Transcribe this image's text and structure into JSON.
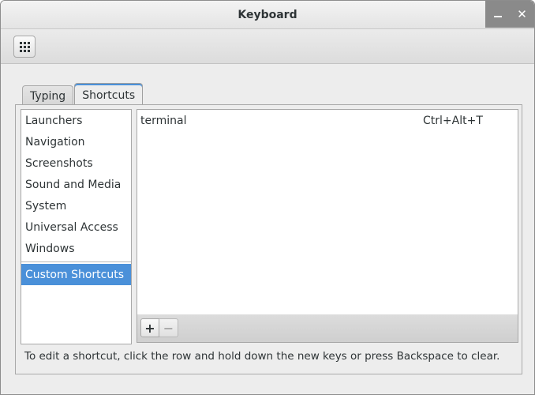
{
  "window": {
    "title": "Keyboard",
    "minimize_label": "",
    "close_label": "✕"
  },
  "toolbar": {
    "overview_icon": "grid-icon"
  },
  "tabs": [
    {
      "label": "Typing",
      "active": false
    },
    {
      "label": "Shortcuts",
      "active": true
    }
  ],
  "categories": [
    {
      "label": "Launchers"
    },
    {
      "label": "Navigation"
    },
    {
      "label": "Screenshots"
    },
    {
      "label": "Sound and Media"
    },
    {
      "label": "System"
    },
    {
      "label": "Universal Access"
    },
    {
      "label": "Windows"
    }
  ],
  "custom_category": {
    "label": "Custom Shortcuts",
    "selected": true
  },
  "shortcuts": [
    {
      "name": "terminal",
      "accel": "Ctrl+Alt+T"
    }
  ],
  "list_toolbar": {
    "add_label": "+",
    "remove_label": "−"
  },
  "hint": "To edit a shortcut, click the row and hold down the new keys or press Backspace to clear.",
  "colors": {
    "selection": "#4a90d9",
    "window_bg": "#ededed"
  }
}
